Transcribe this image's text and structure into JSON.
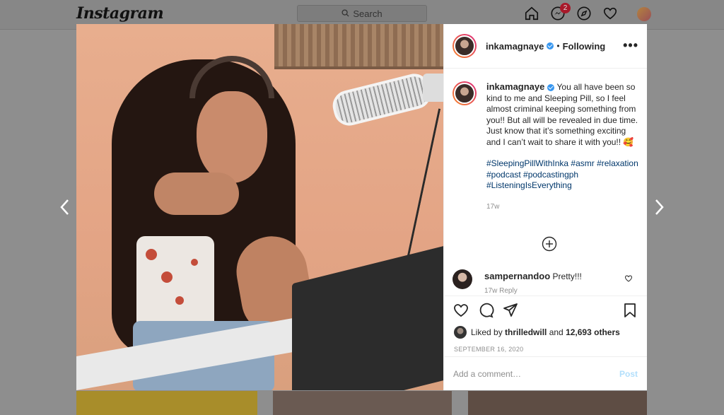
{
  "navbar": {
    "logo": "Instagram",
    "search_placeholder": "Search",
    "messages_badge": "2"
  },
  "post": {
    "username": "inkamagnaye",
    "follow_status": "Following",
    "more_label": "•••",
    "caption_username": "inkamagnaye",
    "caption": "You all have been so kind to me and Sleeping Pill, so I feel almost criminal keeping something from you!! But all will be revealed in due time. Just know that it’s something exciting and I can’t wait to share it with you!! 🥰",
    "hashtags": "#SleepingPillWithInka #asmr #relaxation #podcast #podcastingph #ListeningIsEverything",
    "time_ago": "17w",
    "comment": {
      "username": "sampernandoo",
      "text": "Pretty!!!",
      "meta": "17w    Reply"
    },
    "likes_prefix": "Liked by ",
    "likes_user": "thrilledwill",
    "likes_suffix": " and ",
    "likes_count": "12,693 others",
    "date": "SEPTEMBER 16, 2020",
    "add_comment_placeholder": "Add a comment…",
    "post_button": "Post"
  },
  "colors": {
    "link": "#00376b",
    "verified": "#3897f0",
    "post_button_disabled": "#b2dffc",
    "overlay": "#8e8e8e"
  }
}
